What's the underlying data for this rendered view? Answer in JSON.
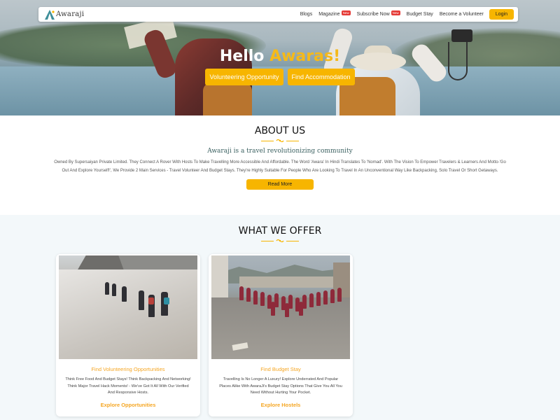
{
  "nav": {
    "logo_text": "Awaraji",
    "links": [
      {
        "label": "Blogs",
        "badge": ""
      },
      {
        "label": "Magazine",
        "badge": "New"
      },
      {
        "label": "Subscribe Now",
        "badge": "New"
      },
      {
        "label": "Budget Stay",
        "badge": ""
      },
      {
        "label": "Become a Volunteer",
        "badge": ""
      }
    ],
    "login_label": "Login"
  },
  "hero": {
    "title_white": "Hello",
    "title_yellow": "Awaras!",
    "buttons": [
      "Volunteering Opportunity",
      "Find Accommodation"
    ]
  },
  "about": {
    "title": "ABOUT US",
    "subtitle": "Awaraji is a travel revolutionizing community",
    "body": "Owned By Supersaiyan Private Limited. They Connect A Rover With Hosts To Make Travelling More Accessible And Affordable. The Word 'Awara' In Hindi Translates To 'Nomad'. With The Vision To Empower Travelers & Learners And Motto-'Go Out And Explore Yourself!', We Provide 2 Main Services - Travel Volunteer And Budget Stays. They're Highly Suitable For People Who Are Looking To Travel In An Unconventional Way Like Backpacking, Solo Travel Or Short Getaways.",
    "button": "Read More"
  },
  "offer": {
    "title": "WHAT WE OFFER",
    "cards": [
      {
        "title": "Find Volunteering Opportunities",
        "text": "Think Free Food And Budget Stays! Think Backpacking And Networking! Think Major Travel Hack Moments! - We've Got It All With Our Verified And Responsive Hosts.",
        "link": "Explore Opportunities"
      },
      {
        "title": "Find Budget Stay",
        "text": "Travelling Is No Longer A Luxury! Explore Underrated And Popular Places Alike With AwaraJi's Budget Stay Options That Give You All You Need Without Hurting Your Pocket.",
        "link": "Explore Hostels"
      }
    ]
  },
  "colors": {
    "accent": "#f7b500",
    "link": "#f5a623",
    "badge": "#e53935",
    "offer_bg": "#f3f8fa",
    "subtitle": "#3a6060"
  },
  "icons": [
    "logo-tent-icon",
    "divider-ornament-icon"
  ]
}
